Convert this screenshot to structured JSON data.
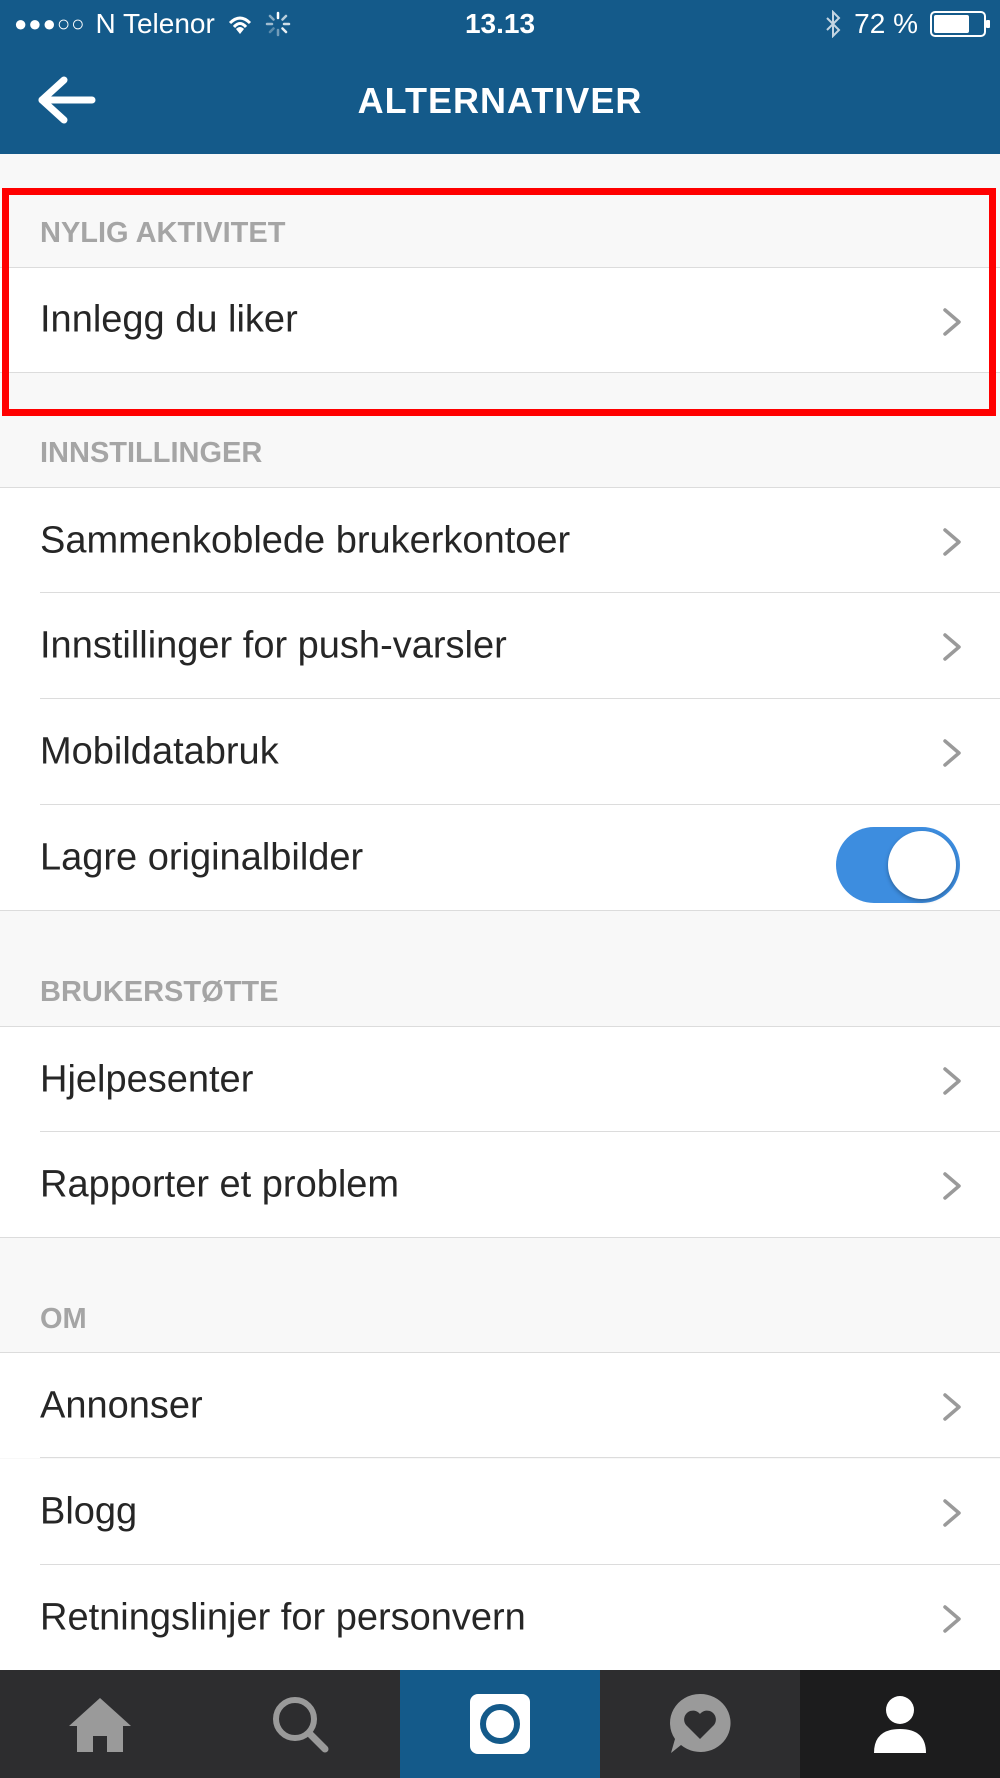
{
  "status_bar": {
    "signal": "●●●○○",
    "carrier": "N Telenor",
    "time": "13.13",
    "battery_text": "72 %",
    "battery_level": 0.72
  },
  "header": {
    "title": "ALTERNATIVER"
  },
  "sections": [
    {
      "header": "NYLIG AKTIVITET",
      "items": [
        {
          "label": "Innlegg du liker"
        }
      ]
    },
    {
      "header": "INNSTILLINGER",
      "items": [
        {
          "label": "Sammenkoblede brukerkontoer"
        },
        {
          "label": "Innstillinger for push-varsler"
        },
        {
          "label": "Mobildatabruk"
        },
        {
          "label": "Lagre originalbilder",
          "toggle": true
        }
      ]
    },
    {
      "header": "BRUKERSTØTTE",
      "items": [
        {
          "label": "Hjelpesenter"
        },
        {
          "label": "Rapporter et problem"
        }
      ]
    },
    {
      "header": "OM",
      "items": [
        {
          "label": "Annonser"
        },
        {
          "label": "Blogg"
        },
        {
          "label": "Retningslinjer for personvern"
        }
      ]
    }
  ],
  "colors": {
    "header_bg": "#145A8A",
    "toggle_on": "#3d8ddf",
    "highlight": "#ff0000",
    "tabbar_bg": "#2d2d2f"
  },
  "tabs": [
    {
      "icon": "home-icon"
    },
    {
      "icon": "search-icon"
    },
    {
      "icon": "camera-icon"
    },
    {
      "icon": "activity-heart-icon"
    },
    {
      "icon": "profile-icon"
    }
  ]
}
